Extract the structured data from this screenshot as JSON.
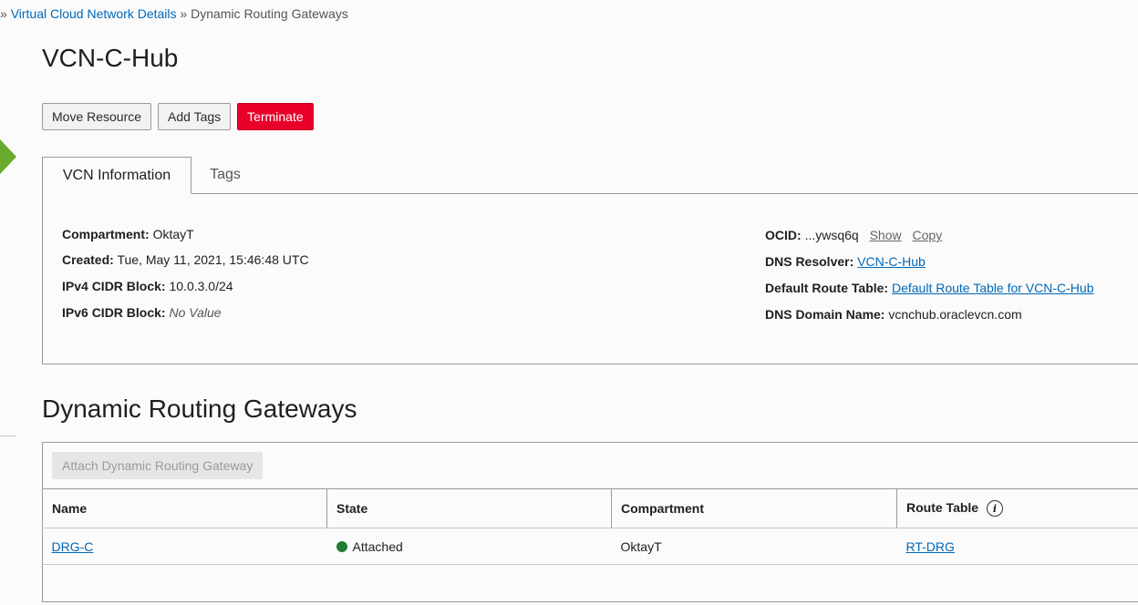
{
  "breadcrumb": {
    "prefix": "»",
    "link": "Virtual Cloud Network Details",
    "separator": "»",
    "current": "Dynamic Routing Gateways"
  },
  "page_title": "VCN-C-Hub",
  "actions": {
    "move_resource": "Move Resource",
    "add_tags": "Add Tags",
    "terminate": "Terminate"
  },
  "tabs": {
    "vcn_information": "VCN Information",
    "tags": "Tags"
  },
  "info_left": {
    "compartment_label": "Compartment:",
    "compartment_value": "OktayT",
    "created_label": "Created:",
    "created_value": "Tue, May 11, 2021, 15:46:48 UTC",
    "ipv4_label": "IPv4 CIDR Block:",
    "ipv4_value": "10.0.3.0/24",
    "ipv6_label": "IPv6 CIDR Block:",
    "ipv6_value": "No Value"
  },
  "info_right": {
    "ocid_label": "OCID:",
    "ocid_value": "...ywsq6q",
    "show": "Show",
    "copy": "Copy",
    "dns_resolver_label": "DNS Resolver:",
    "dns_resolver_value": "VCN-C-Hub",
    "default_route_label": "Default Route Table:",
    "default_route_value": "Default Route Table for VCN-C-Hub",
    "dns_domain_label": "DNS Domain Name:",
    "dns_domain_value": "vcnchub.oraclevcn.com"
  },
  "section_title": "Dynamic Routing Gateways",
  "attach_button": "Attach Dynamic Routing Gateway",
  "table": {
    "headers": {
      "name": "Name",
      "state": "State",
      "compartment": "Compartment",
      "route_table": "Route Table",
      "route_table_info_icon": "i"
    },
    "rows": [
      {
        "name": "DRG-C",
        "state": "Attached",
        "compartment": "OktayT",
        "route_table": "RT-DRG"
      }
    ]
  },
  "colors": {
    "link": "#0068b8",
    "danger": "#e8002b",
    "status_attached": "#1e7d32",
    "accent_green": "#6aab2d"
  }
}
